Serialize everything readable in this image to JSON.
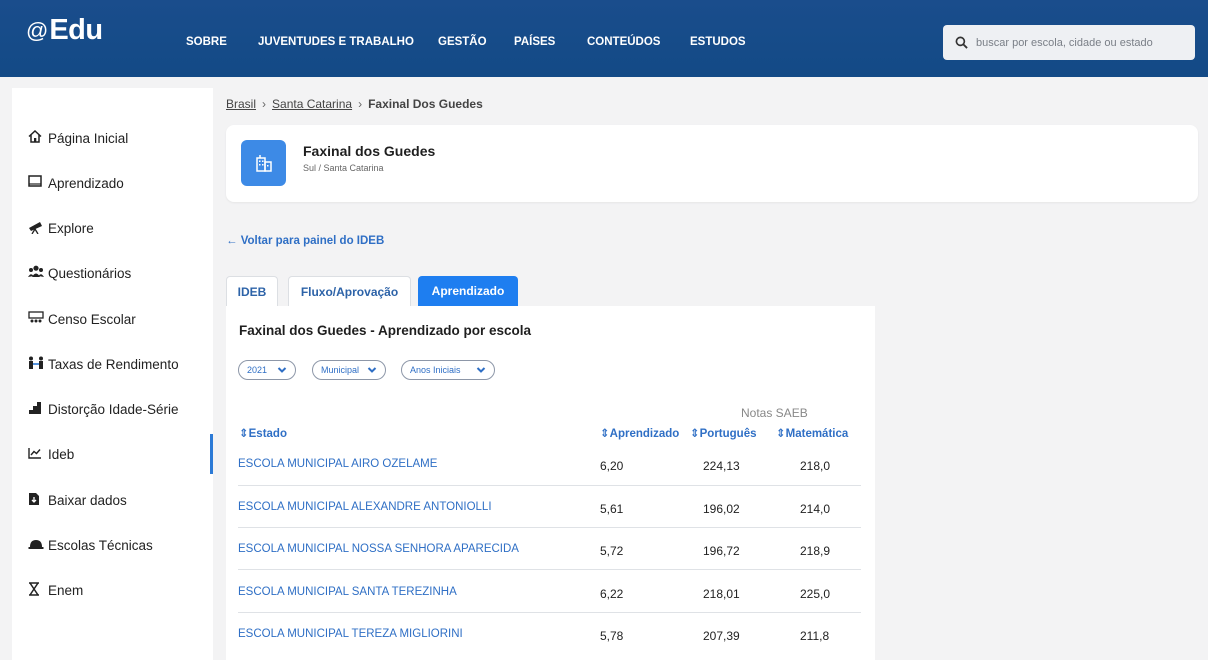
{
  "header": {
    "logo_symbol": "@",
    "logo_text": "Edu",
    "nav": [
      "SOBRE",
      "JUVENTUDES E TRABALHO",
      "GESTÃO",
      "PAÍSES",
      "CONTEÚDOS",
      "ESTUDOS"
    ],
    "search_placeholder": "buscar por escola, cidade ou estado"
  },
  "sidebar": {
    "items": [
      {
        "label": "Página Inicial",
        "icon": "home-icon"
      },
      {
        "label": "Aprendizado",
        "icon": "book-icon"
      },
      {
        "label": "Explore",
        "icon": "telescope-icon"
      },
      {
        "label": "Questionários",
        "icon": "users-icon"
      },
      {
        "label": "Censo Escolar",
        "icon": "census-icon"
      },
      {
        "label": "Taxas de Rendimento",
        "icon": "people-exchange-icon"
      },
      {
        "label": "Distorção Idade-Série",
        "icon": "stairs-icon"
      },
      {
        "label": "Ideb",
        "icon": "chart-line-icon"
      },
      {
        "label": "Baixar dados",
        "icon": "file-download-icon"
      },
      {
        "label": "Escolas Técnicas",
        "icon": "helmet-icon"
      },
      {
        "label": "Enem",
        "icon": "hourglass-icon"
      }
    ],
    "active_item": "Ideb"
  },
  "breadcrumb": {
    "items": [
      "Brasil",
      "Santa Catarina",
      "Faxinal Dos Guedes"
    ],
    "separator": "›"
  },
  "city": {
    "name": "Faxinal dos Guedes",
    "region": "Sul / Santa Catarina",
    "icon": "building-icon"
  },
  "back_link": "← Voltar para painel do IDEB",
  "tabs": [
    {
      "label": "IDEB",
      "active": false
    },
    {
      "label": "Fluxo/Aprovação",
      "active": false
    },
    {
      "label": "Aprendizado",
      "active": true
    }
  ],
  "panel": {
    "title": "Faxinal dos Guedes - Aprendizado por escola",
    "filters": {
      "year": "2021",
      "network": "Municipal",
      "stage": "Anos Iniciais"
    },
    "group_header": "Notas SAEB",
    "columns": [
      "⇕Estado",
      "⇕Aprendizado",
      "⇕Português",
      "⇕Matemática"
    ],
    "rows": [
      {
        "school": "ESCOLA MUNICIPAL AIRO OZELAME",
        "aprendizado": "6,20",
        "portugues": "224,13",
        "matematica": "218,0"
      },
      {
        "school": "ESCOLA MUNICIPAL ALEXANDRE ANTONIOLLI",
        "aprendizado": "5,61",
        "portugues": "196,02",
        "matematica": "214,0"
      },
      {
        "school": "ESCOLA MUNICIPAL NOSSA SENHORA APARECIDA",
        "aprendizado": "5,72",
        "portugues": "196,72",
        "matematica": "218,9"
      },
      {
        "school": "ESCOLA MUNICIPAL SANTA TEREZINHA",
        "aprendizado": "6,22",
        "portugues": "218,01",
        "matematica": "225,0"
      },
      {
        "school": "ESCOLA MUNICIPAL TEREZA MIGLIORINI",
        "aprendizado": "5,78",
        "portugues": "207,39",
        "matematica": "211,8"
      }
    ]
  },
  "colors": {
    "header_bg": "#134a86",
    "accent": "#1e7ef0",
    "link": "#2f6fc5"
  }
}
